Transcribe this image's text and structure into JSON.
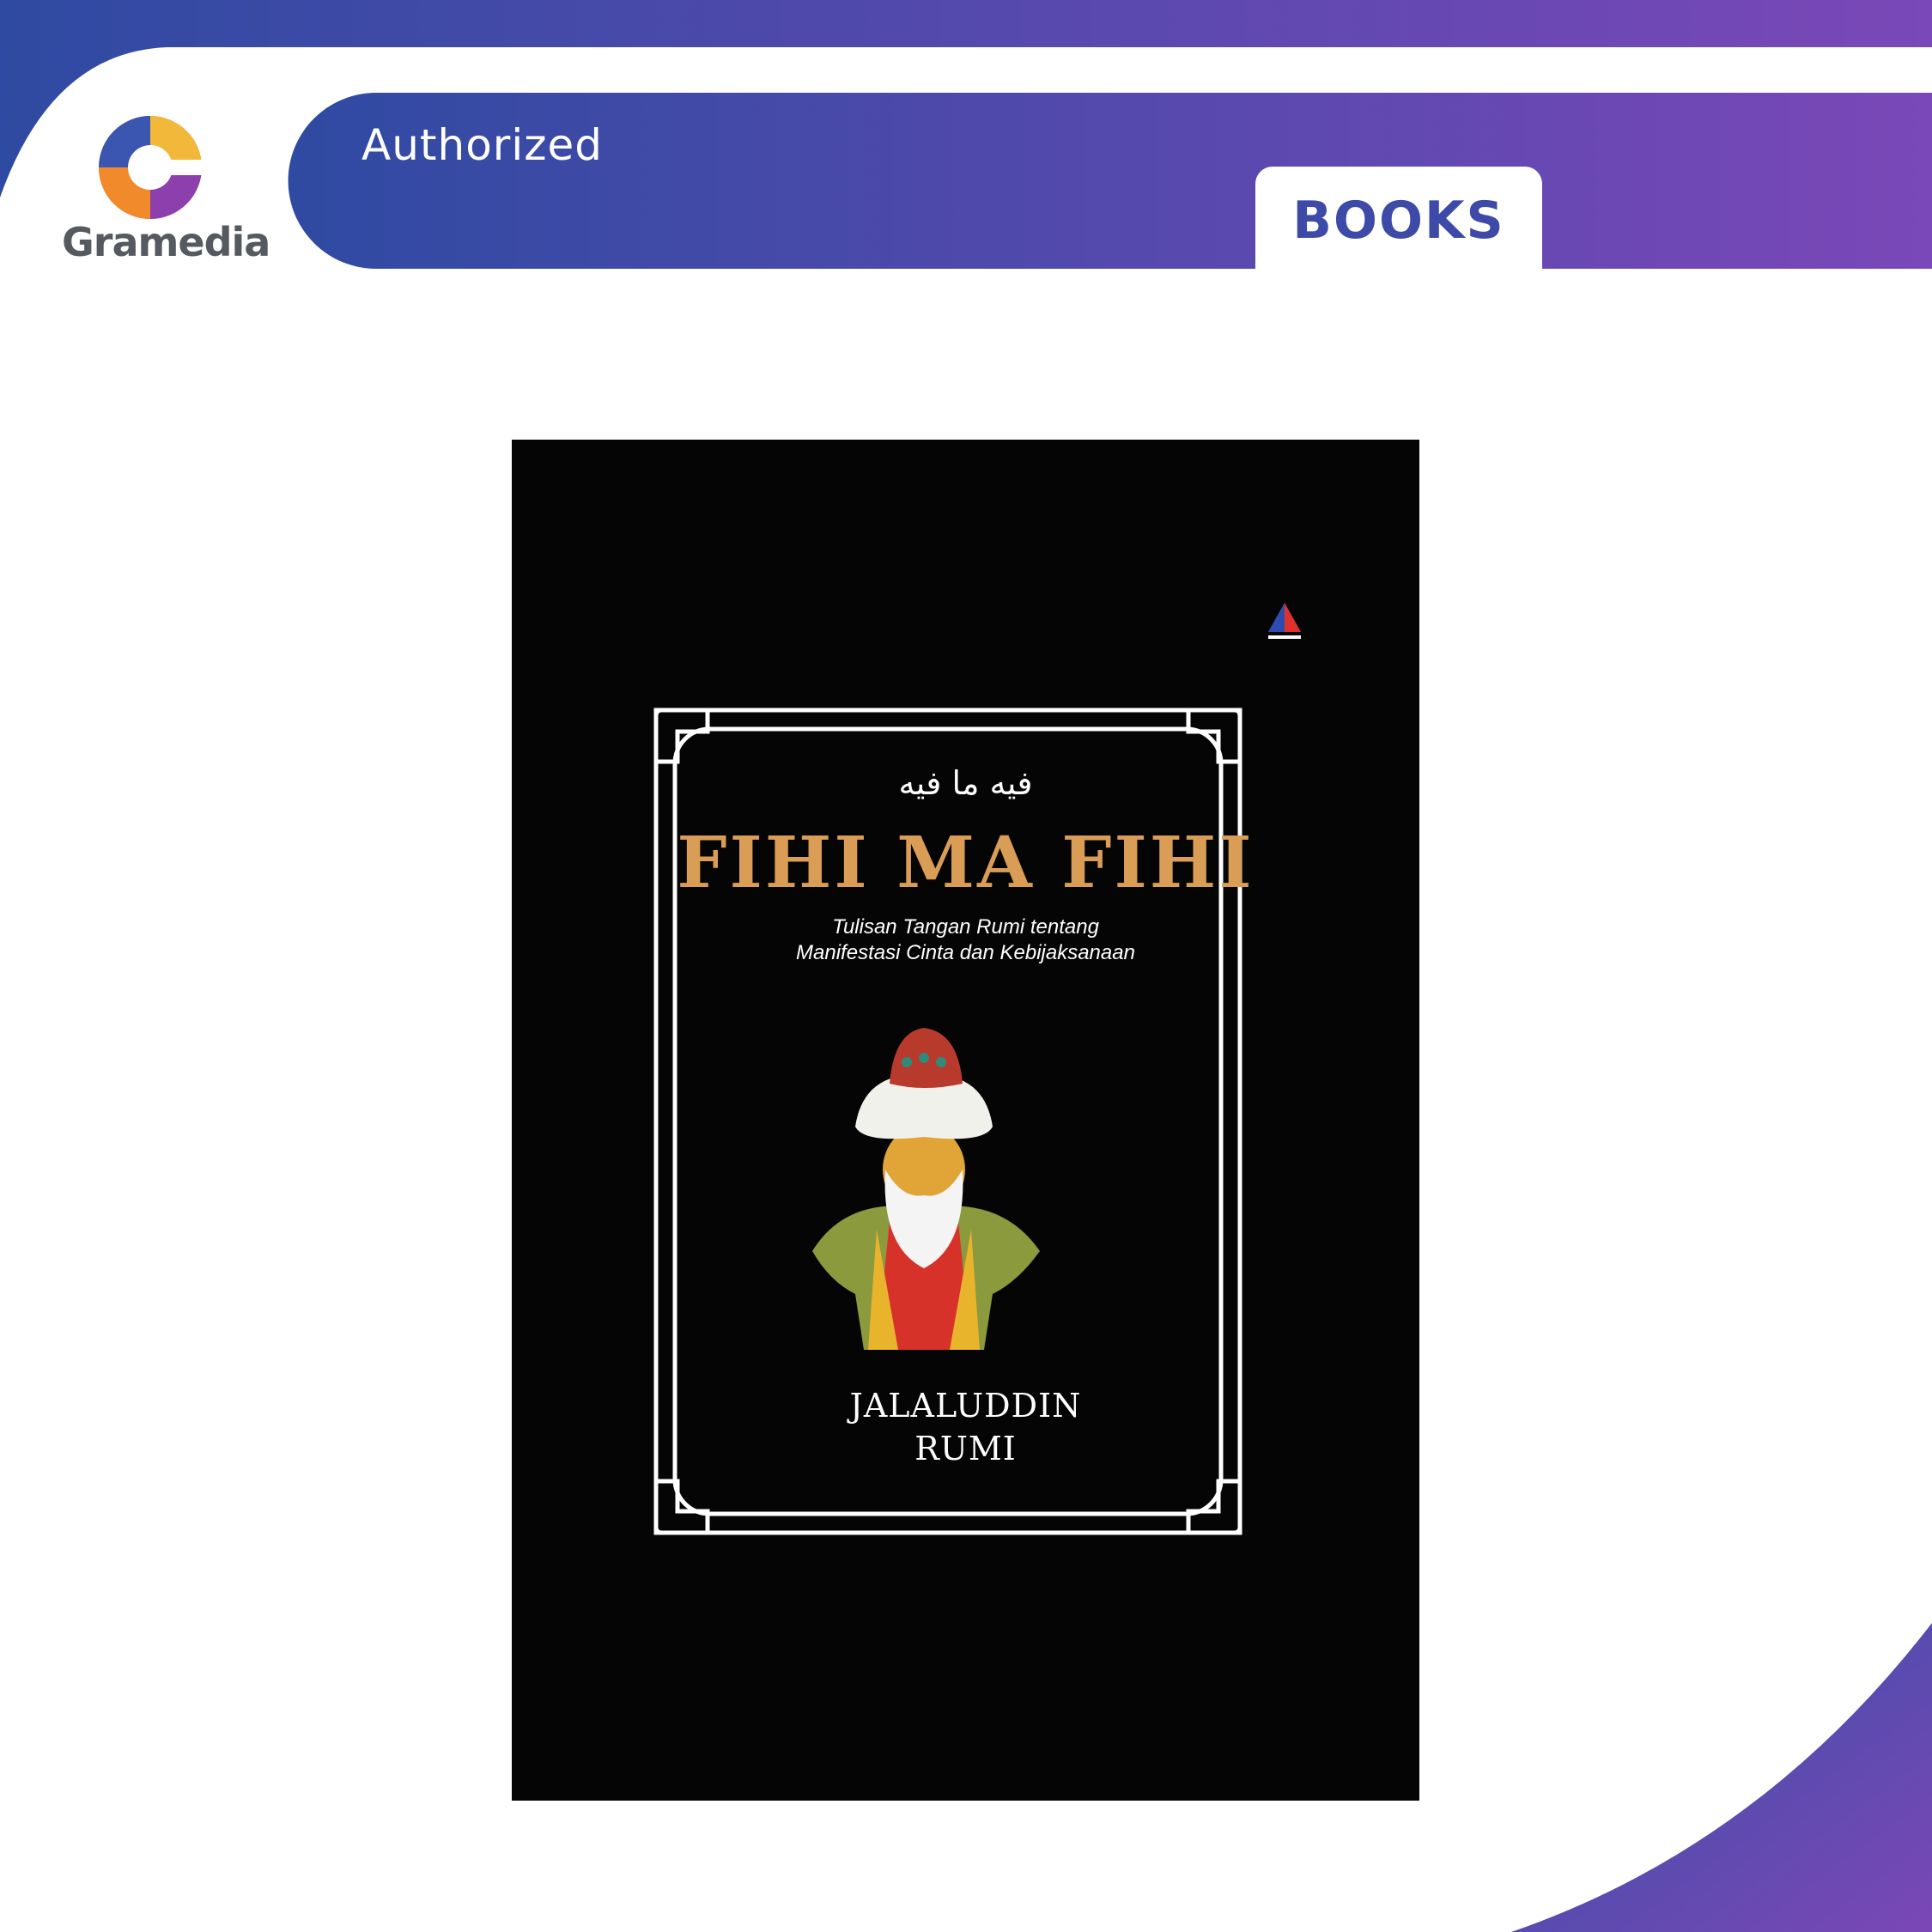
{
  "brand": {
    "logo_text": "Gramedia",
    "primary_gradient_start": "#2f4aa2",
    "primary_gradient_end": "#7a48b8"
  },
  "banner": {
    "authorized_label": "Authorized",
    "category_tab": "BOOKS"
  },
  "cover": {
    "arabic_title": "فيه ما فيه",
    "title": "FIHI MA FIHI",
    "subtitle": "Tulisan Tangan Rumi tentang\nManifestasi Cinta dan Kebijaksanaan",
    "author": "JALALUDDIN\nRUMI",
    "background_color": "#050505",
    "title_color": "#d99d55"
  }
}
